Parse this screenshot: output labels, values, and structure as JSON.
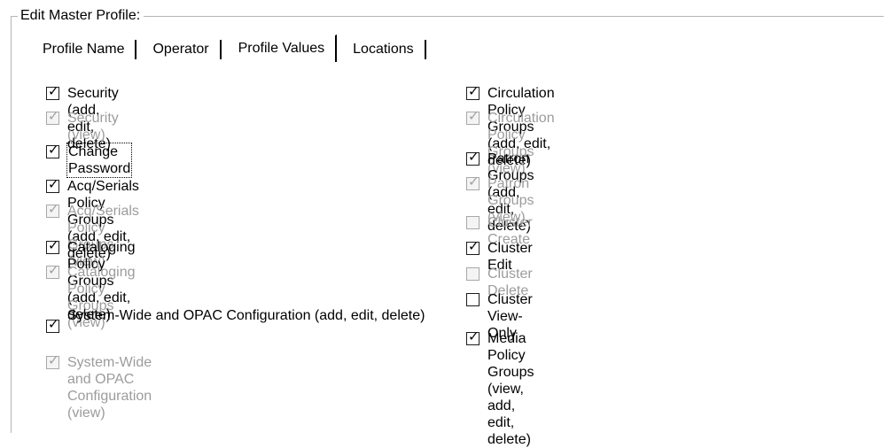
{
  "group": {
    "title": "Edit Master Profile:"
  },
  "tabs": [
    {
      "label": "Profile Name"
    },
    {
      "label": "Operator"
    },
    {
      "label": "Profile Values"
    },
    {
      "label": "Locations"
    }
  ],
  "left_options": [
    {
      "label": "Security (add, edit, delete)",
      "checked": true,
      "disabled": false
    },
    {
      "label": "Security (view)",
      "checked": true,
      "disabled": true
    },
    {
      "label": "Change Password",
      "checked": true,
      "disabled": false
    },
    {
      "label": "Acq/Serials Policy Groups (add, edit, delete)",
      "checked": true,
      "disabled": false
    },
    {
      "label": "Acq/Serials Policy Groups (view)",
      "checked": true,
      "disabled": true
    },
    {
      "label": "Cataloging Policy Groups (add, edit, delete)",
      "checked": true,
      "disabled": false
    },
    {
      "label": "Cataloging Policy Groups (view)",
      "checked": true,
      "disabled": true
    },
    {
      "label": "System-Wide and OPAC Configuration (add, edit, delete)",
      "checked": true,
      "disabled": false
    },
    {
      "label": "System-Wide and OPAC Configuration (view)",
      "checked": true,
      "disabled": true
    }
  ],
  "right_options": [
    {
      "label": "Circulation Policy Groups (add, edit, delete)",
      "checked": true,
      "disabled": false
    },
    {
      "label": "Circulation Policy Groups (view)",
      "checked": true,
      "disabled": true
    },
    {
      "label": "Patron Groups (add, edit, delete)",
      "checked": true,
      "disabled": false
    },
    {
      "label": "Patron Groups (view)",
      "checked": true,
      "disabled": true
    },
    {
      "label": "Cluster Create",
      "checked": false,
      "disabled": true
    },
    {
      "label": "Cluster Edit",
      "checked": true,
      "disabled": false
    },
    {
      "label": "Cluster Delete",
      "checked": false,
      "disabled": true
    },
    {
      "label": "Cluster View-Only",
      "checked": false,
      "disabled": false
    },
    {
      "label": "Media Policy Groups (view, add, edit, delete)",
      "checked": true,
      "disabled": false
    }
  ]
}
